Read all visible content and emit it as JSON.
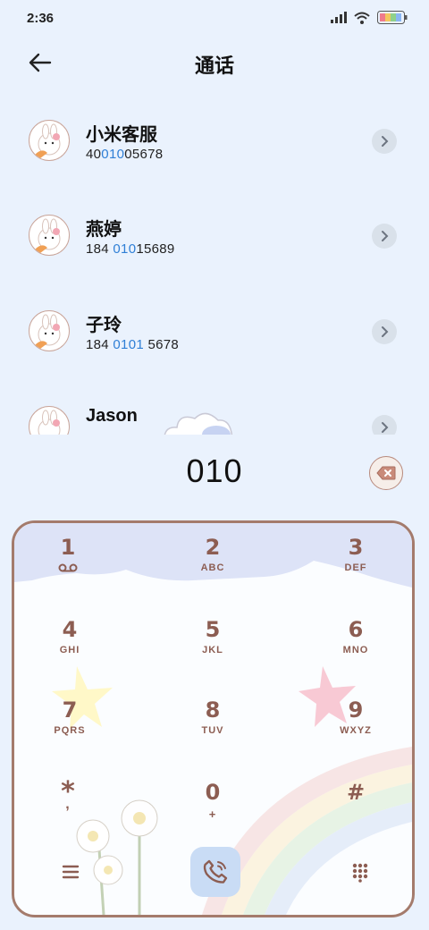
{
  "status": {
    "time": "2:36"
  },
  "header": {
    "title": "通话"
  },
  "contacts": [
    {
      "name": "小米客服",
      "number_parts": [
        "40",
        "010",
        "05678"
      ]
    },
    {
      "name": "燕婷",
      "number_parts": [
        "184 ",
        "010",
        "15689"
      ]
    },
    {
      "name": "子玲",
      "number_parts": [
        "184 ",
        "0101",
        " 5678"
      ]
    },
    {
      "name": "Jason",
      "number_parts": [
        "",
        "",
        ""
      ]
    }
  ],
  "dialer": {
    "entered": "010",
    "keys": [
      {
        "digit": "1",
        "letters": ""
      },
      {
        "digit": "2",
        "letters": "ABC"
      },
      {
        "digit": "3",
        "letters": "DEF"
      },
      {
        "digit": "4",
        "letters": "GHI"
      },
      {
        "digit": "5",
        "letters": "JKL"
      },
      {
        "digit": "6",
        "letters": "MNO"
      },
      {
        "digit": "7",
        "letters": "PQRS"
      },
      {
        "digit": "8",
        "letters": "TUV"
      },
      {
        "digit": "9",
        "letters": "WXYZ"
      },
      {
        "digit": "*",
        "letters": ","
      },
      {
        "digit": "0",
        "letters": "+"
      },
      {
        "digit": "#",
        "letters": ""
      }
    ]
  },
  "colors": {
    "accent": "#2f7fd6",
    "keypad_text": "#8c5d52",
    "pad_border": "#a47b6c"
  },
  "icons": [
    "back-arrow-icon",
    "chevron-right-icon",
    "backspace-icon",
    "voicemail-icon",
    "phone-icon",
    "menu-icon",
    "dialpad-icon"
  ]
}
